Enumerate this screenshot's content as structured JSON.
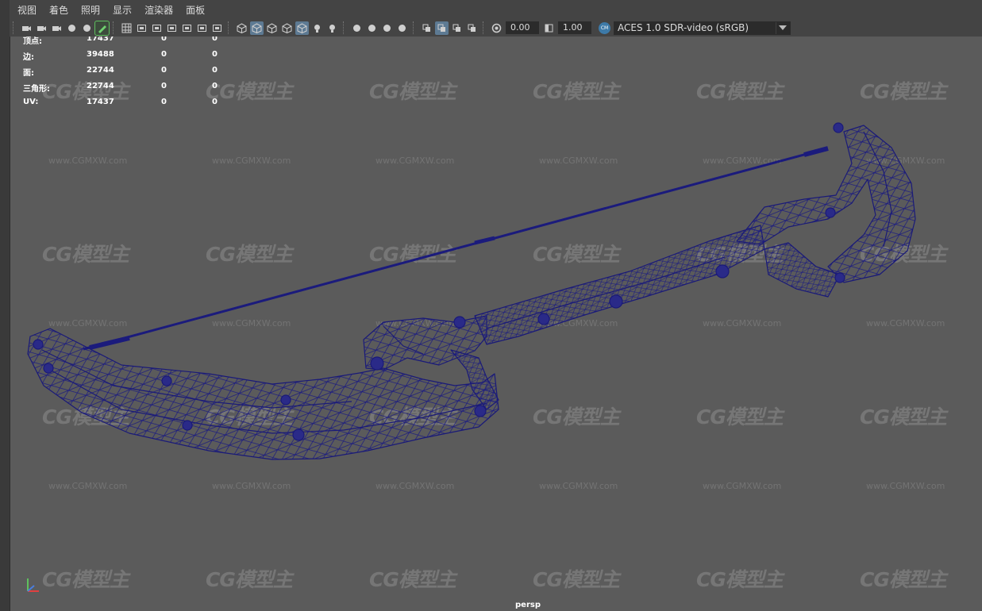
{
  "menu": [
    "视图",
    "着色",
    "照明",
    "显示",
    "渲染器",
    "面板"
  ],
  "toolbar": {
    "groups": [
      [
        "camera-icon",
        "camera-attributes-icon",
        "camera-lock-icon",
        "bookmark-icon",
        "image-plane-icon",
        "grease-pencil-icon"
      ],
      [
        "grid-icon",
        "film-gate-icon",
        "resolution-gate-icon",
        "gate-mask-icon",
        "field-chart-icon",
        "safe-action-icon",
        "safe-title-icon"
      ],
      [
        "wireframe-icon",
        "smooth-shade-icon",
        "default-material-icon",
        "wireframe-on-shaded-icon",
        "textured-icon",
        "use-lights-icon",
        "shadows-icon"
      ],
      [
        "ambient-occlusion-icon",
        "motion-blur-icon",
        "anti-aliasing-icon",
        "depth-of-field-icon"
      ],
      [
        "isolate-select-icon",
        "xray-icon",
        "xray-joints-icon",
        "xray-active-icon"
      ],
      [
        "exposure-icon"
      ]
    ],
    "exposure_value": "0.00",
    "gamma_value": "1.00",
    "color_space": "ACES 1.0 SDR-video (sRGB)"
  },
  "hud": [
    {
      "label": "顶点:",
      "value": "17437",
      "a": "0",
      "b": "0"
    },
    {
      "label": "边:",
      "value": "39488",
      "a": "0",
      "b": "0"
    },
    {
      "label": "面:",
      "value": "22744",
      "a": "0",
      "b": "0"
    },
    {
      "label": "三角形:",
      "value": "22744",
      "a": "0",
      "b": "0"
    },
    {
      "label": "UV:",
      "value": "17437",
      "a": "0",
      "b": "0"
    }
  ],
  "camera": "persp",
  "watermark": {
    "logo": "CG模型主",
    "url": "www.CGMXW.com"
  },
  "colors": {
    "viewport": "#5b5b5b",
    "wireframe": "#1a1a78",
    "accent": "#5d7a93"
  }
}
